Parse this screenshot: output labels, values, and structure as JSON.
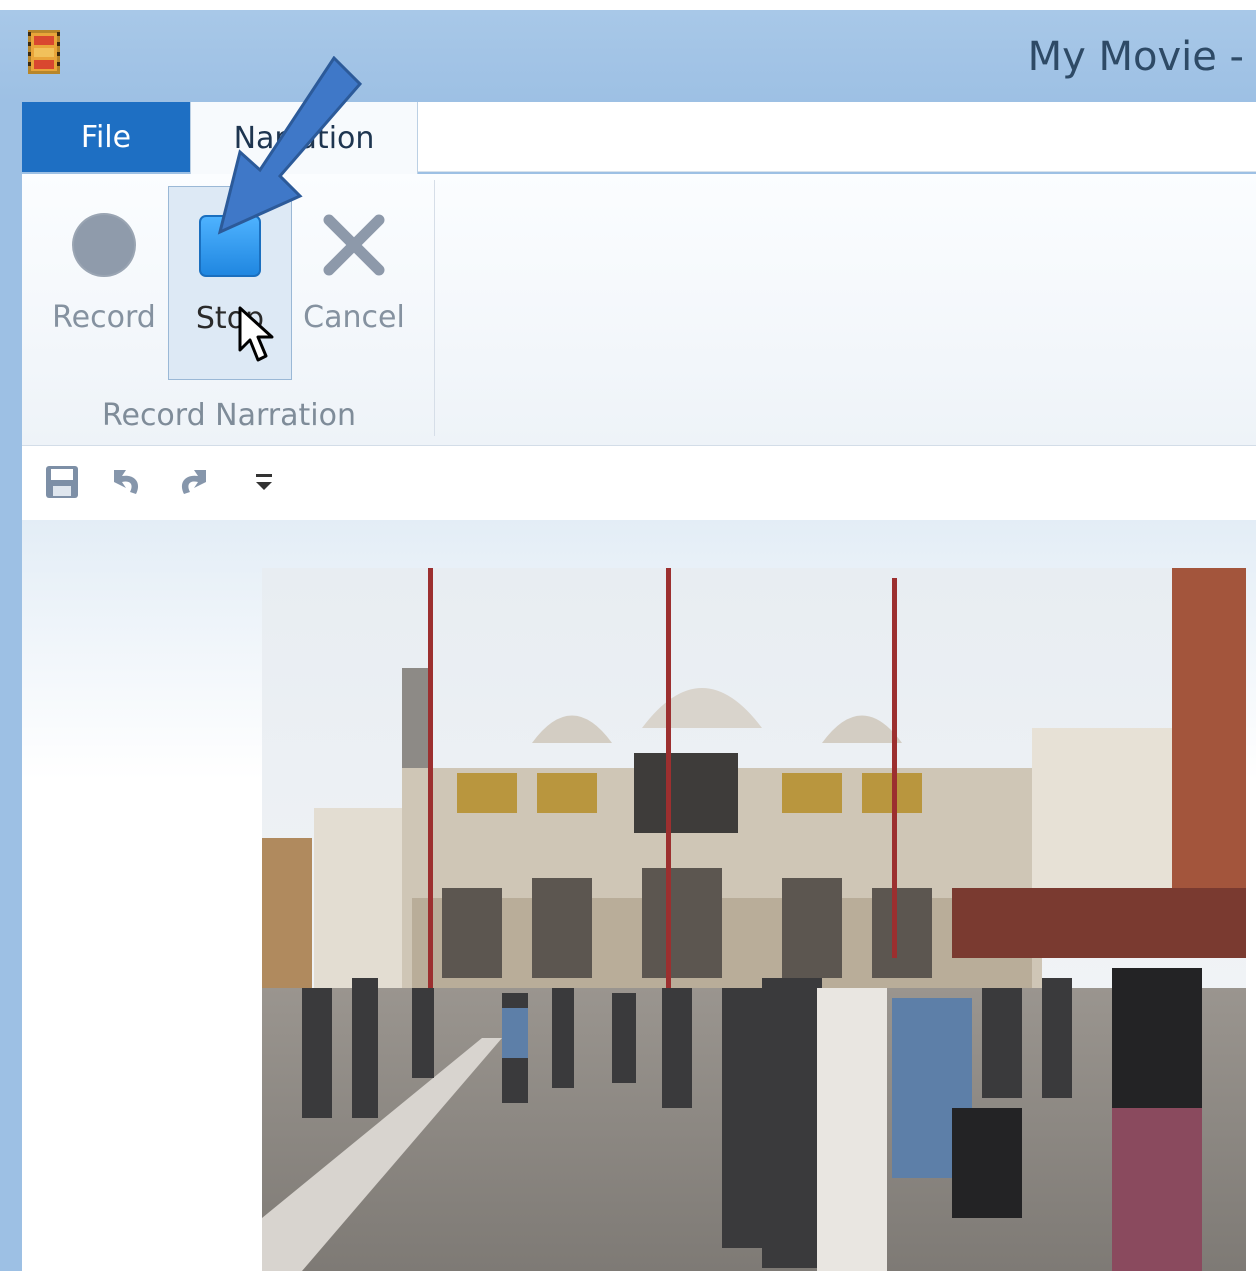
{
  "window": {
    "title": "My Movie - "
  },
  "ribbon": {
    "tabs": {
      "file": "File",
      "narration": "Narration"
    },
    "group": {
      "label": "Record Narration",
      "buttons": {
        "record": "Record",
        "stop": "Stop",
        "cancel": "Cancel"
      }
    }
  },
  "quick_access": {
    "items": [
      "save-icon",
      "undo-icon",
      "redo-icon",
      "customize-dropdown-icon"
    ]
  },
  "colors": {
    "file_tab": "#1e6fc3",
    "stop_icon": "#2e9bf0",
    "annotation_arrow": "#3f78c8"
  }
}
